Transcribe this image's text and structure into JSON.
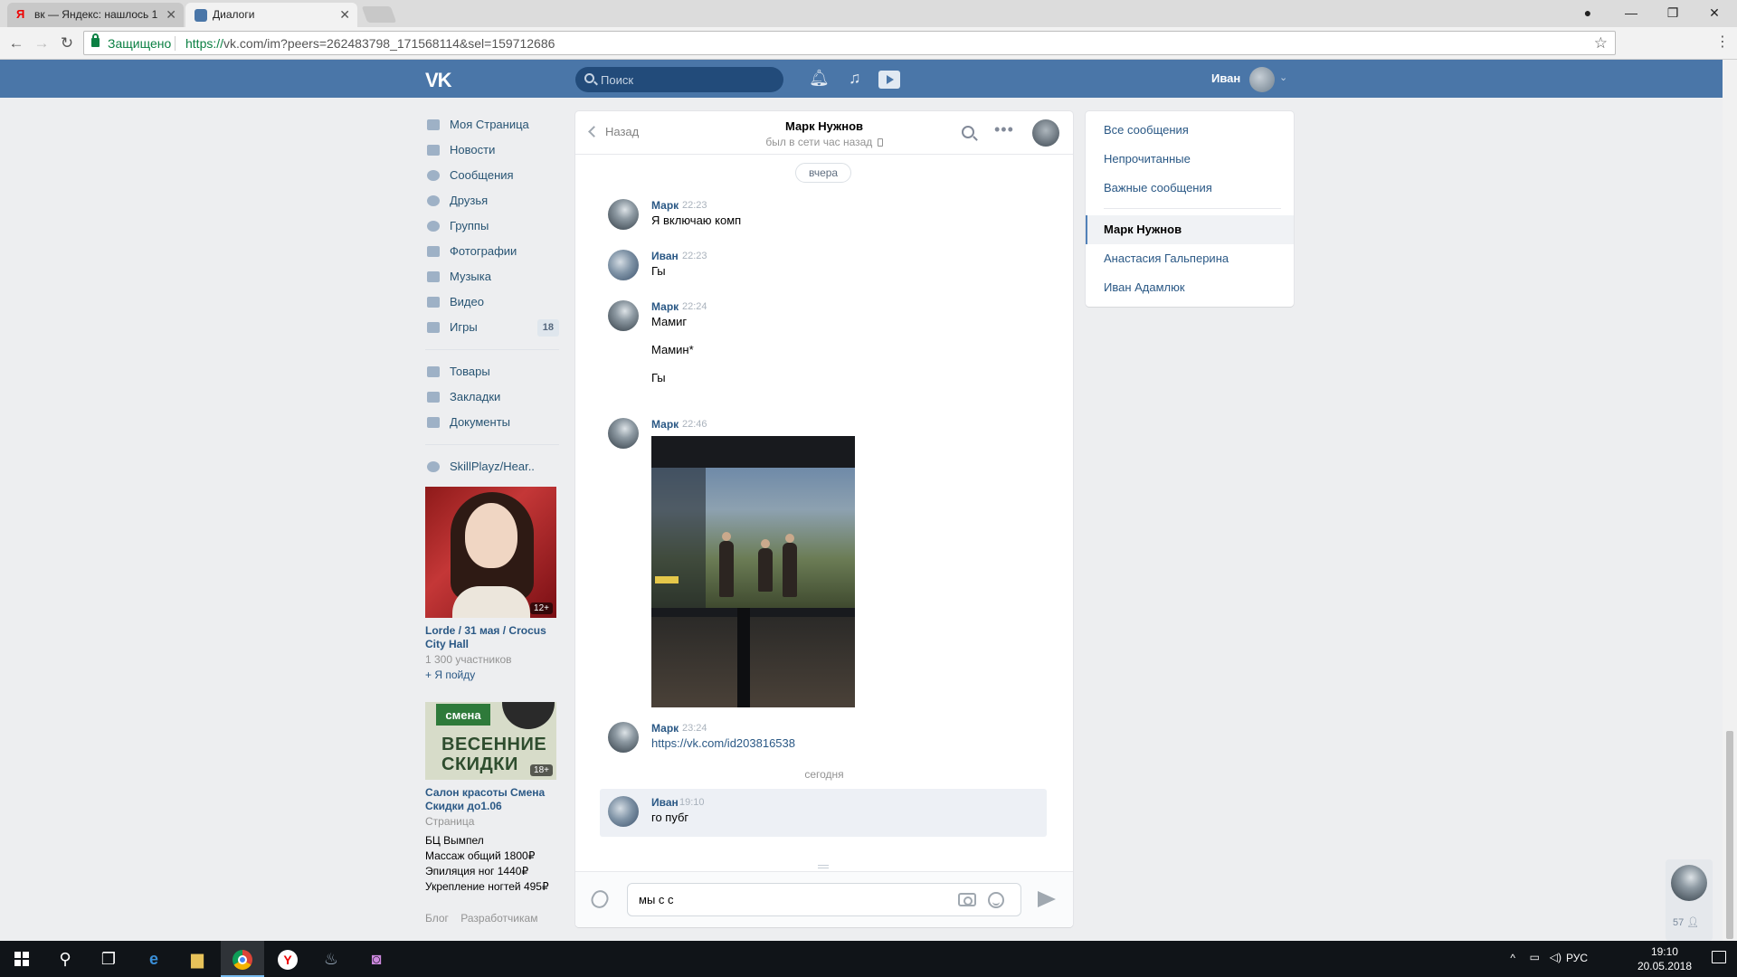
{
  "browser": {
    "tabs": [
      {
        "title": "вк — Яндекс: нашлось 1",
        "active": false
      },
      {
        "title": "Диалоги",
        "active": true
      }
    ],
    "secure_label": "Защищено",
    "url_proto": "https://",
    "url_rest": "vk.com/im?peers=262483798_171568114&sel=159712686"
  },
  "vk_header": {
    "logo": "VK",
    "search_placeholder": "Поиск",
    "user_name": "Иван"
  },
  "left_nav": {
    "items": [
      {
        "label": "Моя Страница",
        "icon": "home-icon"
      },
      {
        "label": "Новости",
        "icon": "news-icon"
      },
      {
        "label": "Сообщения",
        "icon": "messages-icon"
      },
      {
        "label": "Друзья",
        "icon": "friends-icon"
      },
      {
        "label": "Группы",
        "icon": "groups-icon"
      },
      {
        "label": "Фотографии",
        "icon": "camera-icon"
      },
      {
        "label": "Музыка",
        "icon": "music-icon"
      },
      {
        "label": "Видео",
        "icon": "video-icon"
      },
      {
        "label": "Игры",
        "icon": "games-icon",
        "badge": "18"
      }
    ],
    "items2": [
      {
        "label": "Товары",
        "icon": "bag-icon"
      },
      {
        "label": "Закладки",
        "icon": "star-icon"
      },
      {
        "label": "Документы",
        "icon": "document-icon"
      }
    ],
    "items3": [
      {
        "label": "SkillPlayz/Hear..",
        "icon": "group-icon"
      }
    ]
  },
  "ads": [
    {
      "age": "12+",
      "title": "Lorde / 31 мая / Crocus City Hall",
      "meta": "1 300 участников",
      "action": "+ Я пойду"
    },
    {
      "age": "18+",
      "banner_tag": "смена",
      "banner_text": "ВЕСЕННИЕ СКИДКИ",
      "title": "Салон красоты Смена Скидки до1.06",
      "meta": "Страница",
      "lines": [
        "БЦ Вымпел",
        "Массаж общий 1800₽",
        "Эпиляция ног 1440₽",
        "Укрепление ногтей 495₽"
      ]
    }
  ],
  "footer_links": [
    "Блог",
    "Разработчикам"
  ],
  "chat": {
    "back_label": "Назад",
    "contact_name": "Марк Нужнов",
    "status": "был в сети час назад",
    "day_yesterday": "вчера",
    "day_today": "сегодня",
    "messages": [
      {
        "author": "Марк",
        "time": "22:23",
        "lines": [
          "Я включаю комп"
        ]
      },
      {
        "author": "Иван",
        "time": "22:23",
        "lines": [
          "Гы"
        ]
      },
      {
        "author": "Марк",
        "time": "22:24",
        "lines": [
          "Мамиг",
          "Мамин*",
          "Гы"
        ]
      },
      {
        "author": "Марк",
        "time": "22:46",
        "lines": []
      },
      {
        "author": "Марк",
        "time": "23:24",
        "lines": [
          "https://vk.com/id203816538"
        ]
      },
      {
        "author": "Иван",
        "time": "19:10",
        "lines": [
          "го пубг"
        ]
      }
    ],
    "draft": "мы с с"
  },
  "right_panel": {
    "filters": [
      "Все сообщения",
      "Непрочитанные",
      "Важные сообщения"
    ],
    "peers": [
      "Марк Нужнов",
      "Анастасия Гальперина",
      "Иван Адамлюк"
    ],
    "selected_peer": "Марк Нужнов"
  },
  "mini_chat": {
    "count": "57"
  },
  "taskbar": {
    "lang": "РУС",
    "time": "19:10",
    "date": "20.05.2018"
  }
}
